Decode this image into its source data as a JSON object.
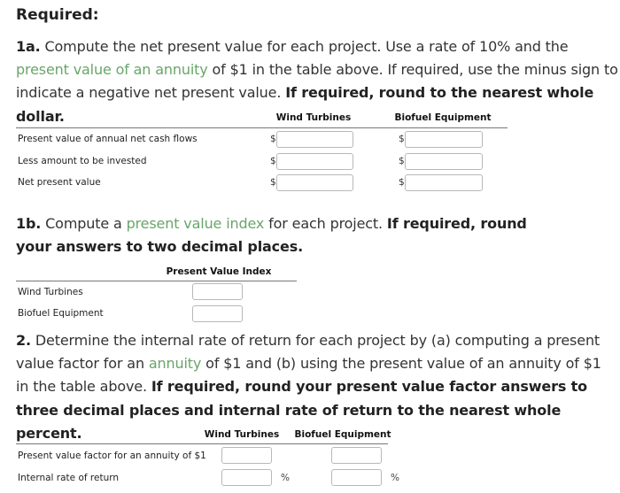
{
  "required_heading": "Required:",
  "q1a": {
    "label": "1a.",
    "text1": " Compute the net present value for each project. Use a rate of 10% and the ",
    "link1": "present value of an annuity",
    "text2": " of $1 in the table above. If required, use the minus sign to indicate a negative net present value. ",
    "bold": "If required, round to the nearest whole dollar.",
    "table": {
      "columns": [
        "Wind Turbines",
        "Biofuel Equipment"
      ],
      "rows": [
        {
          "label": "Present value of annual net cash flows",
          "prefix": "$",
          "values": [
            "",
            ""
          ]
        },
        {
          "label": "Less amount to be invested",
          "prefix": "$",
          "values": [
            "",
            ""
          ]
        },
        {
          "label": "Net present value",
          "prefix": "$",
          "values": [
            "",
            ""
          ]
        }
      ]
    }
  },
  "q1b": {
    "label": "1b.",
    "text1": " Compute a ",
    "link1": "present value index",
    "text2": " for each project. ",
    "bold": "If required, round your answers to two decimal places.",
    "table": {
      "column": "Present Value Index",
      "rows": [
        {
          "label": "Wind Turbines",
          "value": ""
        },
        {
          "label": "Biofuel Equipment",
          "value": ""
        }
      ]
    }
  },
  "q2": {
    "label": "2.",
    "text1": " Determine the internal rate of return for each project by (a) computing a present value factor for an ",
    "link1": "annuity",
    "text2": " of $1 and (b) using the present value of an annuity of $1 in the table above. ",
    "bold": "If required, round your present value factor answers to three decimal places and internal rate of return to the nearest whole percent.",
    "table": {
      "columns": [
        "Wind Turbines",
        "Biofuel Equipment"
      ],
      "rows": [
        {
          "label": "Present value factor for an annuity of $1",
          "suffix": "",
          "values": [
            "",
            ""
          ]
        },
        {
          "label": "Internal rate of return",
          "suffix": "%",
          "values": [
            "",
            ""
          ]
        }
      ]
    }
  }
}
